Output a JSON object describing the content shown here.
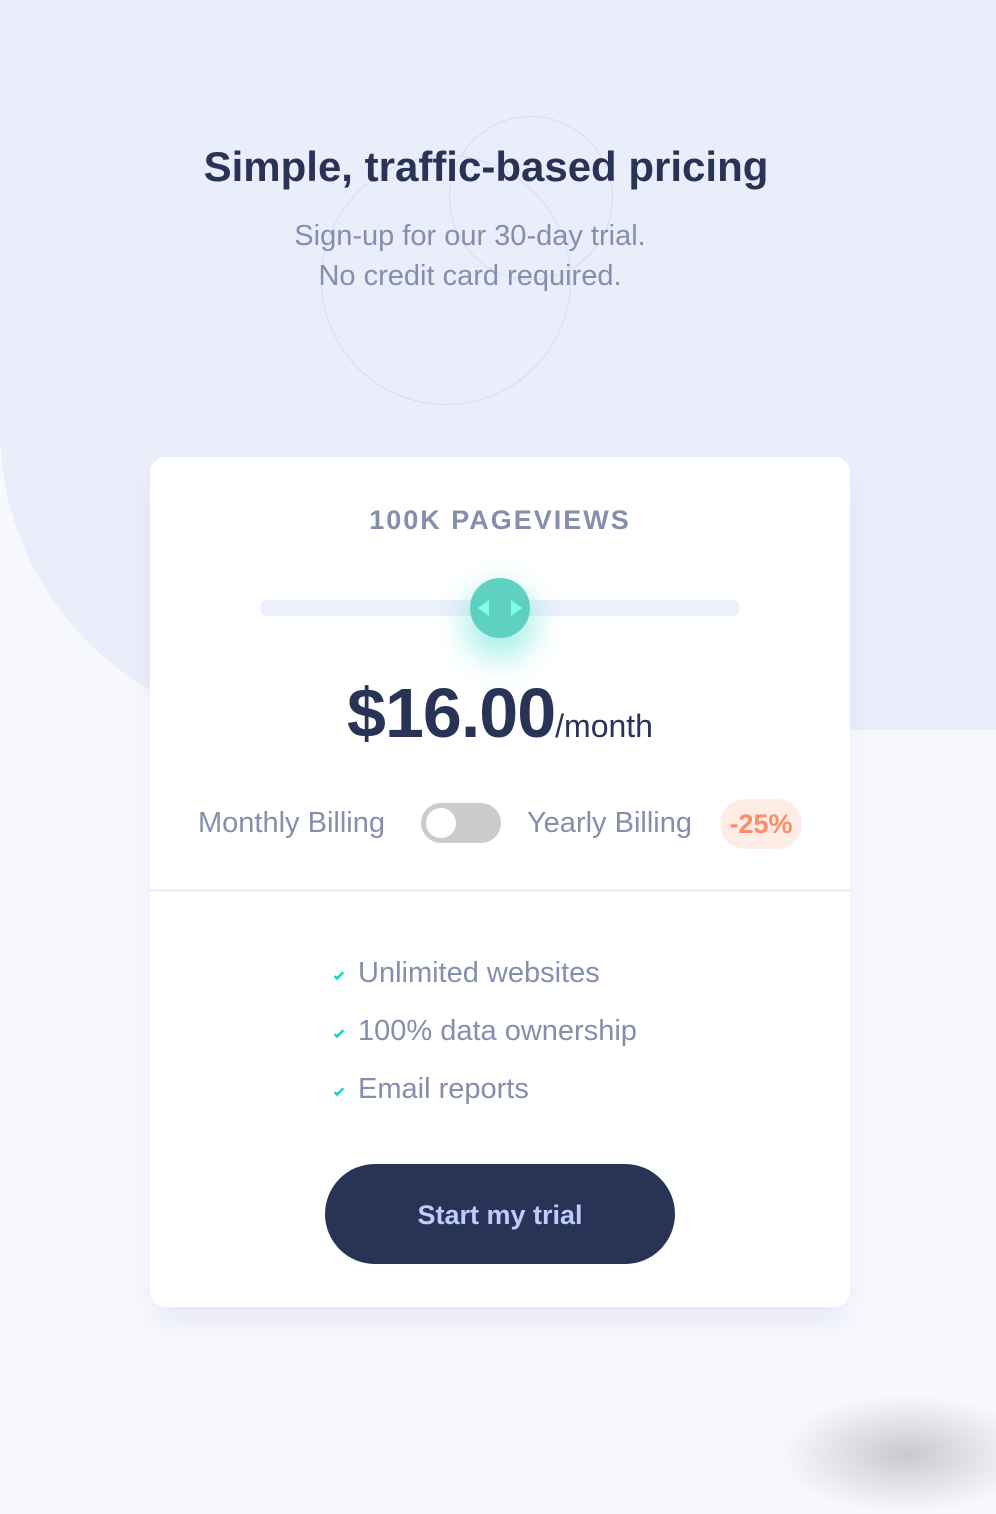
{
  "header": {
    "title": "Simple, traffic-based pricing",
    "subtitle_line1": "Sign-up for our 30-day trial.",
    "subtitle_line2": "No credit card required."
  },
  "card": {
    "pageviews": "100K PAGEVIEWS",
    "slider": {
      "value_fraction": 0.5
    },
    "price": "$16.00",
    "per": "/month",
    "billing": {
      "monthly_label": "Monthly Billing",
      "yearly_label": "Yearly Billing",
      "yearly_enabled": false,
      "discount": "-25%"
    },
    "features": [
      {
        "label": "Unlimited websites",
        "icon": "check-icon"
      },
      {
        "label": "100% data ownership",
        "icon": "check-icon"
      },
      {
        "label": "Email reports",
        "icon": "check-icon"
      }
    ],
    "cta_label": "Start my trial"
  },
  "colors": {
    "accent": "#5ed1c0",
    "dark_navy": "#293356",
    "muted_text": "#858fad",
    "discount_text": "#ff8c66",
    "discount_bg": "#feece7",
    "cta_text": "#bdccff"
  }
}
